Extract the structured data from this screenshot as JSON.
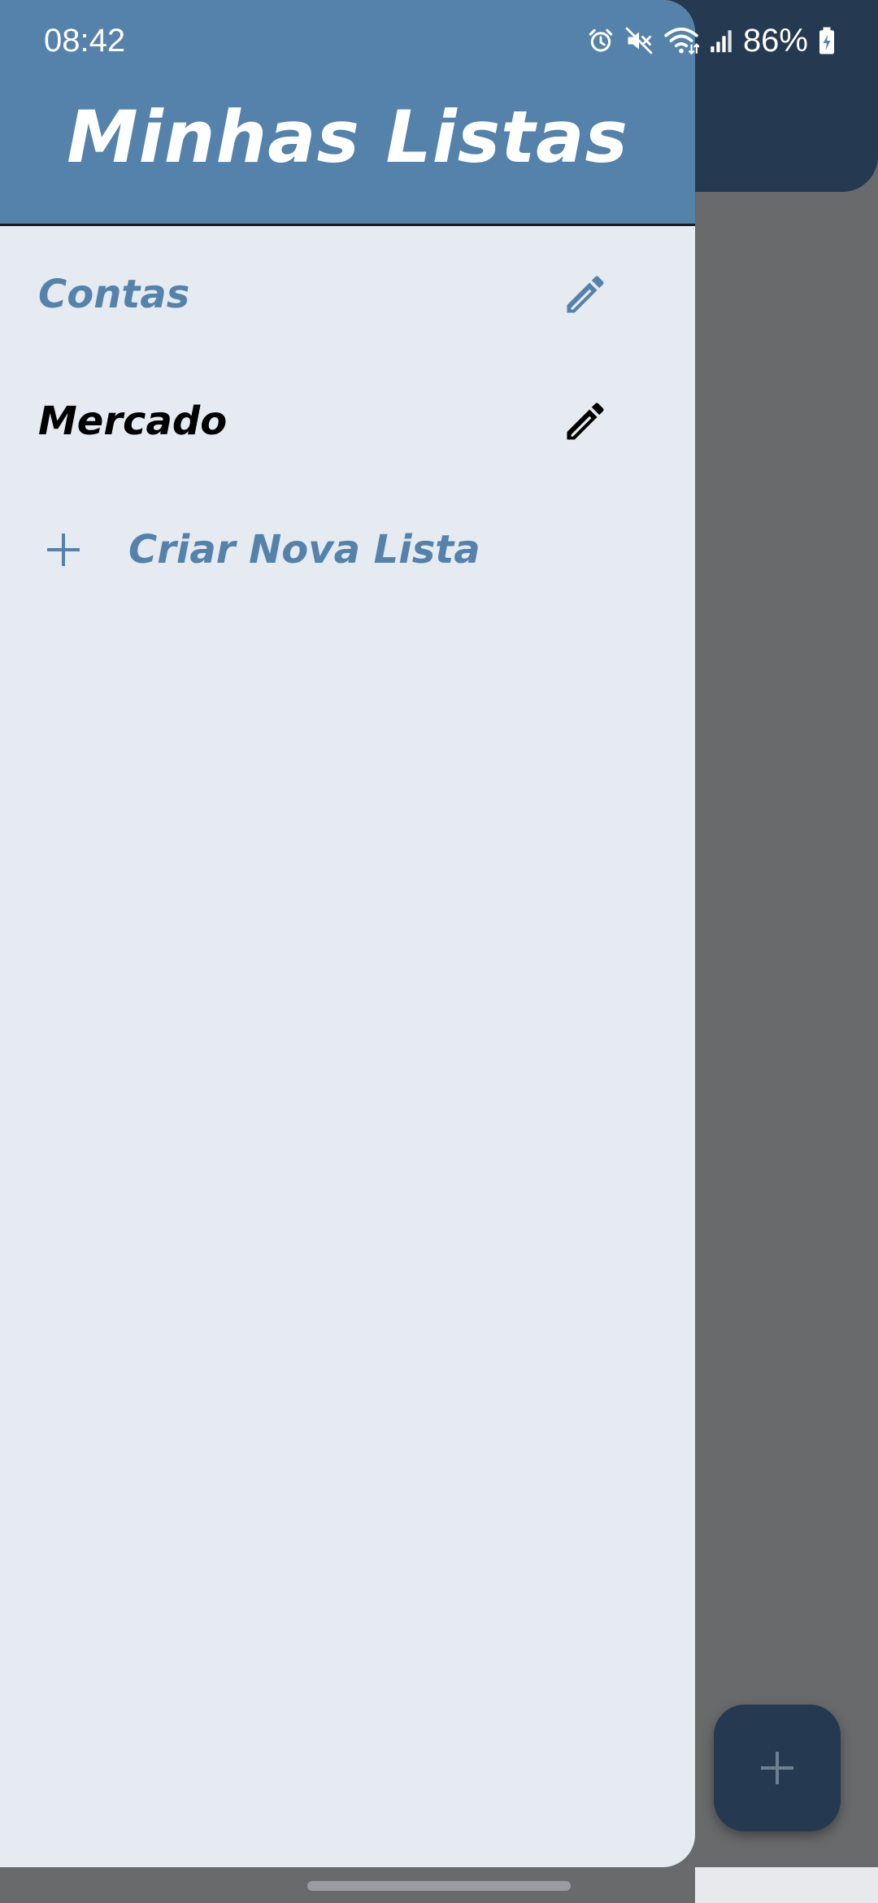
{
  "status_bar": {
    "time": "08:42",
    "battery": "86%",
    "icons": [
      "alarm-icon",
      "mute-icon",
      "wifi-icon",
      "signal-icon",
      "battery-charging-icon"
    ]
  },
  "drawer": {
    "title": "Minhas Listas",
    "lists": [
      {
        "label": "Contas",
        "selected": true,
        "icon": "edit-icon"
      },
      {
        "label": "Mercado",
        "selected": false,
        "icon": "edit-icon"
      }
    ],
    "create_label": "Criar Nova Lista"
  },
  "background": {
    "fab_icon": "add-icon"
  },
  "colors": {
    "drawer_header": "#5482ab",
    "drawer_background": "#e6eaf1",
    "accent": "#5482ab",
    "app_bar_dimmed": "#253a51",
    "scrim": "#696a6c"
  }
}
